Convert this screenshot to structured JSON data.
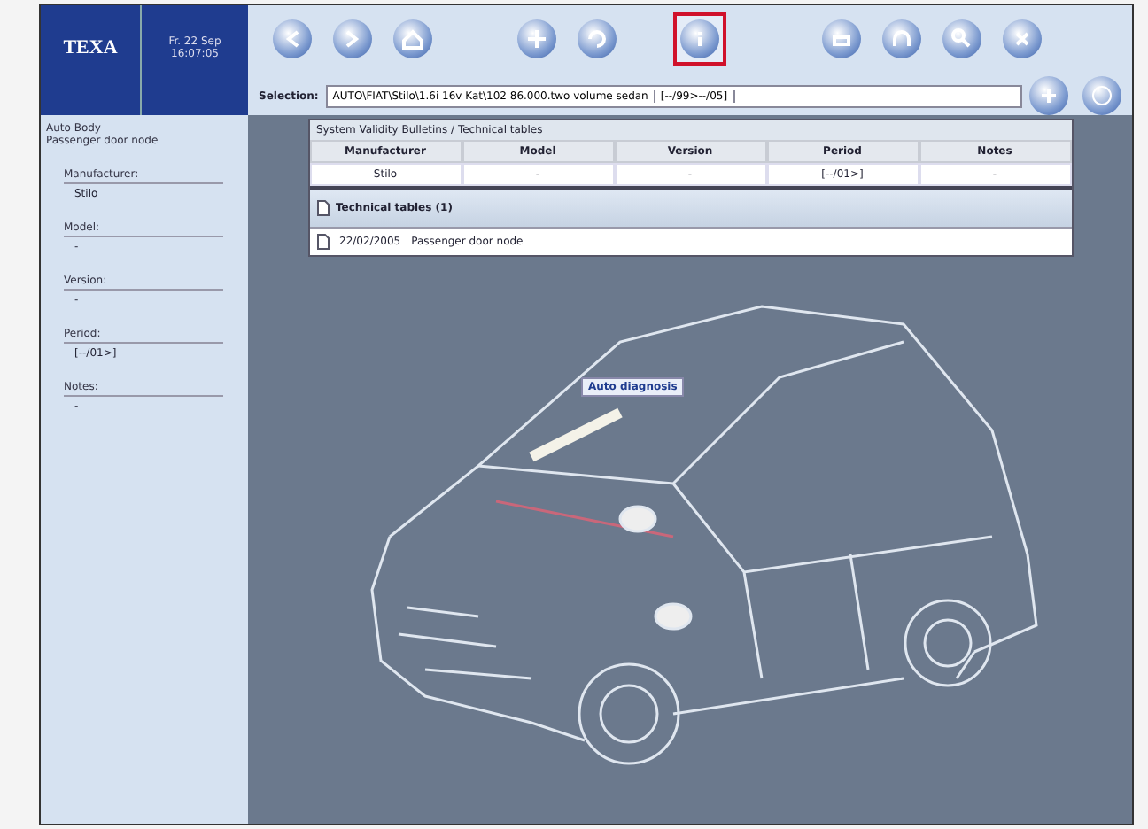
{
  "brand": {
    "logo": "TEXA",
    "date": "Fr. 22 Sep",
    "time": "16:07:05"
  },
  "toolbar": {
    "buttons": [
      {
        "selected": false
      },
      {
        "selected": false
      },
      {
        "selected": false
      },
      {
        "selected": false
      },
      {
        "selected": false
      },
      {
        "selected": true
      },
      {
        "selected": false
      },
      {
        "selected": false
      },
      {
        "selected": false
      },
      {
        "selected": false
      }
    ]
  },
  "selection": {
    "label": "Selection:",
    "value": "AUTO\\FIAT\\Stilo\\1.6i 16v Kat\\102 86.000.two volume sedan",
    "period": "[--/99>--/05]"
  },
  "sidebar": {
    "path": "Auto Body",
    "item": "Passenger door node",
    "fields": [
      {
        "label": "Manufacturer:",
        "value": "Stilo"
      },
      {
        "label": "Model:",
        "value": "-"
      },
      {
        "label": "Version:",
        "value": "-"
      },
      {
        "label": "Period:",
        "value": "[--/01>]"
      },
      {
        "label": "Notes:",
        "value": "-"
      }
    ]
  },
  "panel": {
    "title": "System Validity Bulletins / Technical tables",
    "columns": [
      "Manufacturer",
      "Model",
      "Version",
      "Period",
      "Notes"
    ],
    "row": [
      "Stilo",
      "-",
      "-",
      "[--/01>]",
      "-"
    ],
    "section": "Technical tables (1)",
    "entries": [
      {
        "date": "22/02/2005",
        "name": "Passenger door node"
      }
    ]
  },
  "drawing": {
    "callout": "Auto diagnosis"
  }
}
